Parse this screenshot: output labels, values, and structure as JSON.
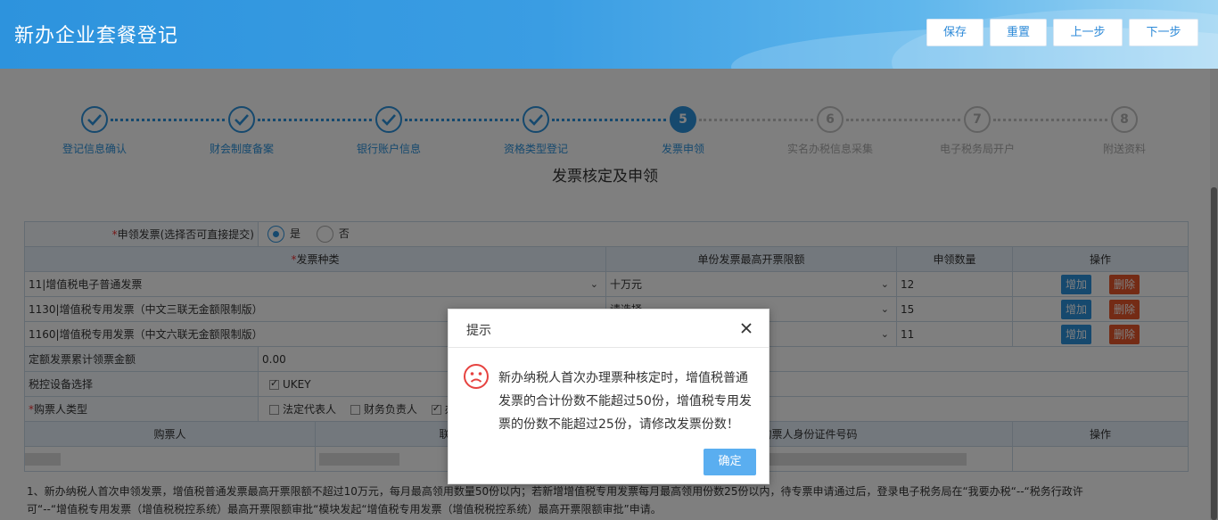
{
  "header": {
    "title": "新办企业套餐登记",
    "buttons": {
      "save": "保存",
      "reset": "重置",
      "prev": "上一步",
      "next": "下一步"
    }
  },
  "steps": [
    {
      "label": "登记信息确认",
      "status": "done"
    },
    {
      "label": "财会制度备案",
      "status": "done"
    },
    {
      "label": "银行账户信息",
      "status": "done"
    },
    {
      "label": "资格类型登记",
      "status": "done"
    },
    {
      "label": "发票申领",
      "status": "current",
      "number": "5"
    },
    {
      "label": "实名办税信息采集",
      "status": "todo",
      "number": "6"
    },
    {
      "label": "电子税务局开户",
      "status": "todo",
      "number": "7"
    },
    {
      "label": "附送资料",
      "status": "todo",
      "number": "8"
    }
  ],
  "section_title": "发票核定及申领",
  "form": {
    "apply_label": "申领发票(选择否可直接提交)",
    "yes": "是",
    "no": "否",
    "col_type": "发票种类",
    "col_limit": "单份发票最高开票限额",
    "col_qty": "申领数量",
    "col_ops": "操作",
    "add": "增加",
    "del": "删除",
    "rows": [
      {
        "type": "11|增值税电子普通发票",
        "limit": "十万元",
        "qty": "12"
      },
      {
        "type": "1130|增值税专用发票（中文三联无金额限制版）",
        "limit": "请选择",
        "qty": "15"
      },
      {
        "type": "1160|增值税专用发票（中文六联无金额限制版）",
        "limit": "",
        "qty": "11"
      }
    ],
    "fixed_label": "定额发票累计领票金额",
    "fixed_value": "0.00",
    "device_label": "税控设备选择",
    "device_value": "UKEY",
    "buyer_type_label": "购票人类型",
    "buyer_types": [
      "法定代表人",
      "财务负责人",
      "办"
    ],
    "buyer_cols": {
      "buyer": "购票人",
      "phone": "联系电话",
      "id": "购票人身份证件号码",
      "ops": "操作"
    }
  },
  "notes": [
    "1、新办纳税人首次申领发票，增值税普通发票最高开票限额不超过10万元，每月最高领用数量50份以内；若新增增值税专用发票每月最高领用份数25份以内，待专票申请通过后，登录电子税务局在“我要办税“--“税务行政许",
    "可“--“增值税专用发票（增值税税控系统）最高开票限额审批“模块发起“增值税专用发票（增值税税控系统）最高开票限额审批”申请。"
  ],
  "dialog": {
    "title": "提示",
    "message": "新办纳税人首次办理票种核定时，增值税普通发票的合计份数不能超过50份，增值税专用发票的份数不能超过25份，请修改发票份数！",
    "ok": "确定",
    "icon": "sad-face-icon"
  }
}
